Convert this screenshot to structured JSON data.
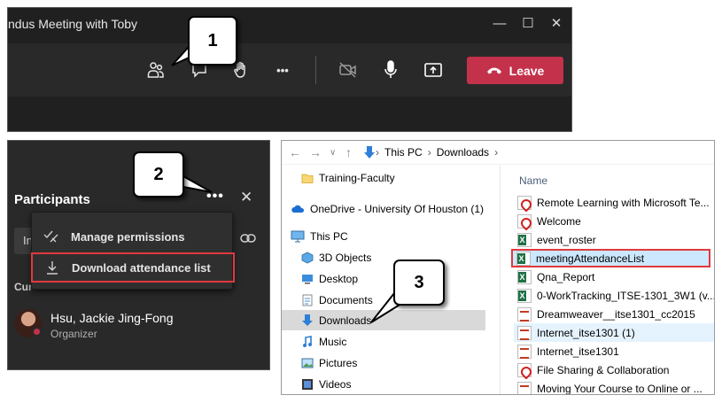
{
  "panel1": {
    "meeting_title": "ndus Meeting with Toby",
    "leave_label": "Leave",
    "more_label": "•••"
  },
  "callouts": {
    "c1": "1",
    "c2": "2",
    "c3": "3"
  },
  "panel2": {
    "heading": "Participants",
    "more_label": "•••",
    "close_label": "✕",
    "input_fragment": "In",
    "current_fragment": "Cur",
    "menu": {
      "manage_permissions": "Manage permissions",
      "download_attendance": "Download attendance list"
    },
    "participant": {
      "name": "Hsu, Jackie Jing-Fong",
      "role": "Organizer"
    }
  },
  "panel3": {
    "path": [
      "This PC",
      "Downloads"
    ],
    "column_header": "Name",
    "tree": [
      {
        "label": "Training-Faculty",
        "icon": "folder-icon"
      },
      {
        "label": "OneDrive - University Of Houston (1)",
        "icon": "onedrive-icon"
      },
      {
        "label": "This PC",
        "icon": "pc-icon"
      },
      {
        "label": "3D Objects",
        "icon": "3d-objects-icon"
      },
      {
        "label": "Desktop",
        "icon": "desktop-icon"
      },
      {
        "label": "Documents",
        "icon": "documents-icon"
      },
      {
        "label": "Downloads",
        "icon": "downloads-icon"
      },
      {
        "label": "Music",
        "icon": "music-icon"
      },
      {
        "label": "Pictures",
        "icon": "pictures-icon"
      },
      {
        "label": "Videos",
        "icon": "videos-icon"
      }
    ],
    "files": [
      {
        "name": "Remote Learning with Microsoft Te...",
        "type": "pdf"
      },
      {
        "name": "Welcome",
        "type": "pdf"
      },
      {
        "name": "event_roster",
        "type": "xls"
      },
      {
        "name": "meetingAttendanceList",
        "type": "xls"
      },
      {
        "name": "Qna_Report",
        "type": "xls"
      },
      {
        "name": "0-WorkTracking_ITSE-1301_3W1 (v...",
        "type": "xls"
      },
      {
        "name": "Dreamweaver__itse1301_cc2015",
        "type": "rtf"
      },
      {
        "name": "Internet_itse1301 (1)",
        "type": "rtf"
      },
      {
        "name": "Internet_itse1301",
        "type": "rtf"
      },
      {
        "name": "File Sharing & Collaboration",
        "type": "pdf"
      },
      {
        "name": "Moving Your Course to Online or ...",
        "type": "rtf"
      }
    ]
  },
  "colors": {
    "teams_dark": "#202020",
    "teams_bar": "#292929",
    "leave_red": "#c4314b",
    "highlight_red": "#e0393e",
    "selection_blue": "#cce8ff"
  }
}
